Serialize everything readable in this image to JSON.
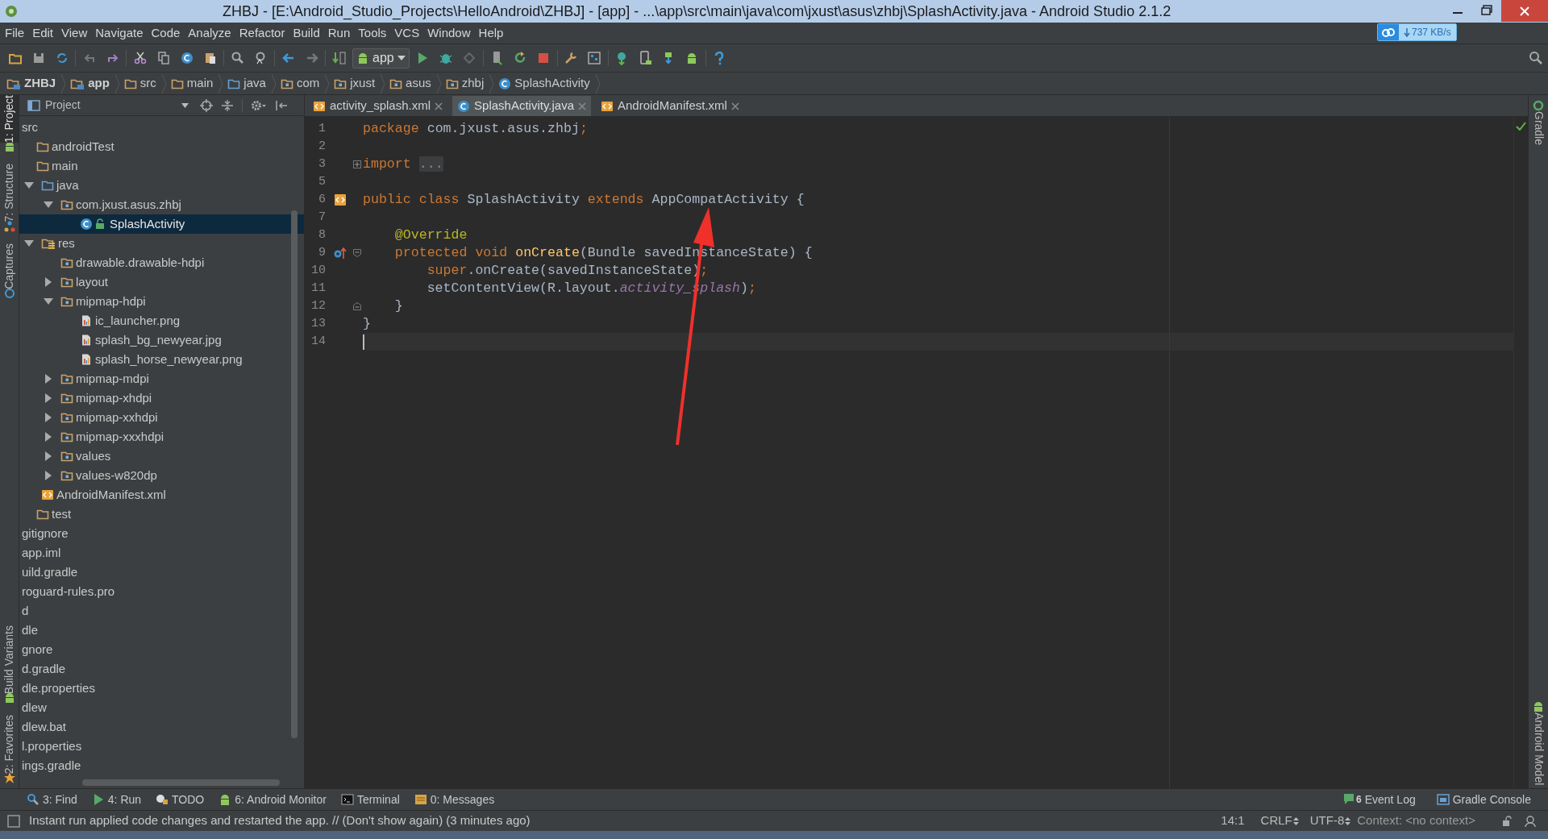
{
  "window": {
    "title": "ZHBJ - [E:\\Android_Studio_Projects\\HelloAndroid\\ZHBJ] - [app] - ...\\app\\src\\main\\java\\com\\jxust\\asus\\zhbj\\SplashActivity.java - Android Studio 2.1.2"
  },
  "network_widget": {
    "speed": "737 KB/s"
  },
  "menu": [
    "File",
    "Edit",
    "View",
    "Navigate",
    "Code",
    "Analyze",
    "Refactor",
    "Build",
    "Run",
    "Tools",
    "VCS",
    "Window",
    "Help"
  ],
  "toolbar": {
    "run_config": "app"
  },
  "breadcrumbs": [
    {
      "label": "ZHBJ",
      "kind": "project"
    },
    {
      "label": "app",
      "kind": "module"
    },
    {
      "label": "src",
      "kind": "folder"
    },
    {
      "label": "main",
      "kind": "folder"
    },
    {
      "label": "java",
      "kind": "source-folder"
    },
    {
      "label": "com",
      "kind": "package"
    },
    {
      "label": "jxust",
      "kind": "package"
    },
    {
      "label": "asus",
      "kind": "package"
    },
    {
      "label": "zhbj",
      "kind": "package"
    },
    {
      "label": "SplashActivity",
      "kind": "class"
    }
  ],
  "left_strip": {
    "top": [
      {
        "label": "1: Project",
        "selected": true
      },
      {
        "label": "7: Structure",
        "selected": false
      },
      {
        "label": "Captures",
        "selected": false
      }
    ],
    "bottom": [
      {
        "label": "Build Variants",
        "selected": false
      },
      {
        "label": "2: Favorites",
        "selected": false
      }
    ]
  },
  "right_strip": {
    "top": [
      "Gradle"
    ],
    "bottom": [
      "Android Model"
    ]
  },
  "project_panel": {
    "view": "Project",
    "tree": [
      {
        "label": "src",
        "selected": false,
        "children": [
          {
            "label": "androidTest",
            "kind": "folder",
            "selected": false
          },
          {
            "label": "main",
            "kind": "folder",
            "selected": false,
            "children": [
              {
                "label": "java",
                "kind": "source-folder",
                "expanded": true,
                "selected": false,
                "children": [
                  {
                    "label": "com.jxust.asus.zhbj",
                    "kind": "package",
                    "expanded": true,
                    "selected": false,
                    "children": [
                      {
                        "label": "SplashActivity",
                        "kind": "class",
                        "selected": true
                      }
                    ]
                  }
                ]
              },
              {
                "label": "res",
                "kind": "resources",
                "expanded": true,
                "selected": false,
                "children": [
                  {
                    "label": "drawable.drawable-hdpi",
                    "kind": "package",
                    "selected": false
                  },
                  {
                    "label": "layout",
                    "kind": "package",
                    "expanded": false,
                    "selected": false
                  },
                  {
                    "label": "mipmap-hdpi",
                    "kind": "package",
                    "expanded": true,
                    "selected": false,
                    "children": [
                      {
                        "label": "ic_launcher.png",
                        "kind": "image",
                        "selected": false
                      },
                      {
                        "label": "splash_bg_newyear.jpg",
                        "kind": "image",
                        "selected": false
                      },
                      {
                        "label": "splash_horse_newyear.png",
                        "kind": "image",
                        "selected": false
                      }
                    ]
                  },
                  {
                    "label": "mipmap-mdpi",
                    "kind": "package",
                    "expanded": false,
                    "selected": false
                  },
                  {
                    "label": "mipmap-xhdpi",
                    "kind": "package",
                    "expanded": false,
                    "selected": false
                  },
                  {
                    "label": "mipmap-xxhdpi",
                    "kind": "package",
                    "expanded": false,
                    "selected": false
                  },
                  {
                    "label": "mipmap-xxxhdpi",
                    "kind": "package",
                    "expanded": false,
                    "selected": false
                  },
                  {
                    "label": "values",
                    "kind": "package",
                    "expanded": false,
                    "selected": false
                  },
                  {
                    "label": "values-w820dp",
                    "kind": "package",
                    "expanded": false,
                    "selected": false
                  }
                ]
              },
              {
                "label": "AndroidManifest.xml",
                "kind": "manifest",
                "selected": false
              }
            ]
          },
          {
            "label": "test",
            "kind": "folder",
            "selected": false
          }
        ]
      },
      {
        "label": "gitignore",
        "selected": false
      },
      {
        "label": "app.iml",
        "selected": false
      },
      {
        "label": "uild.gradle",
        "selected": false
      },
      {
        "label": "roguard-rules.pro",
        "selected": false
      },
      {
        "label": "d",
        "selected": false
      },
      {
        "label": "dle",
        "selected": false
      },
      {
        "label": "gnore",
        "selected": false
      },
      {
        "label": "d.gradle",
        "selected": false
      },
      {
        "label": "dle.properties",
        "selected": false
      },
      {
        "label": "dlew",
        "selected": false
      },
      {
        "label": "dlew.bat",
        "selected": false
      },
      {
        "label": "l.properties",
        "selected": false
      },
      {
        "label": "ings.gradle",
        "selected": false
      }
    ]
  },
  "editor": {
    "tabs": [
      {
        "label": "activity_splash.xml",
        "kind": "xml",
        "selected": false
      },
      {
        "label": "SplashActivity.java",
        "kind": "class",
        "selected": true
      },
      {
        "label": "AndroidManifest.xml",
        "kind": "xml",
        "selected": false
      }
    ],
    "lines": [
      {
        "number": "1",
        "kind": "plain",
        "current": false,
        "tokens": [
          {
            "kind": "keyword",
            "text": "package"
          },
          {
            "kind": "plain",
            "text": " com.jxust.asus.zhbj"
          },
          {
            "kind": "punct",
            "text": ";"
          }
        ]
      },
      {
        "number": "2",
        "kind": "plain",
        "current": false
      },
      {
        "number": "3",
        "kind": "folded-block",
        "current": false,
        "tokens": [
          {
            "kind": "keyword",
            "text": "import "
          },
          {
            "kind": "folded",
            "text": "..."
          }
        ]
      },
      {
        "number": "5",
        "kind": "plain",
        "current": false
      },
      {
        "number": "6",
        "kind": "class-declaration",
        "current": false,
        "tokens": [
          {
            "kind": "keyword",
            "text": "public class"
          },
          {
            "kind": "plain",
            "text": " SplashActivity "
          },
          {
            "kind": "keyword",
            "text": "extends"
          },
          {
            "kind": "plain",
            "text": " AppCompatActivity {"
          }
        ]
      },
      {
        "number": "7",
        "kind": "plain",
        "current": false
      },
      {
        "number": "8",
        "kind": "plain",
        "current": false,
        "tokens": [
          {
            "kind": "annotation",
            "text": "    @Override"
          }
        ]
      },
      {
        "number": "9",
        "kind": "method-declaration",
        "current": false,
        "tokens": [
          {
            "kind": "keyword",
            "text": "    protected void "
          },
          {
            "kind": "method",
            "text": "onCreate"
          },
          {
            "kind": "plain",
            "text": "(Bundle savedInstanceState) {"
          }
        ]
      },
      {
        "number": "10",
        "kind": "plain",
        "current": false,
        "tokens": [
          {
            "kind": "keyword",
            "text": "        super"
          },
          {
            "kind": "plain",
            "text": ".onCreate(savedInstanceState)"
          },
          {
            "kind": "punct",
            "text": ";"
          }
        ]
      },
      {
        "number": "11",
        "kind": "plain",
        "current": false,
        "tokens": [
          {
            "kind": "plain",
            "text": "        setContentView(R.layout."
          },
          {
            "kind": "field",
            "text": "activity_splash"
          },
          {
            "kind": "plain",
            "text": ")"
          },
          {
            "kind": "punct",
            "text": ";"
          }
        ]
      },
      {
        "number": "12",
        "kind": "block-end",
        "current": false,
        "tokens": [
          {
            "kind": "plain",
            "text": "    }"
          }
        ]
      },
      {
        "number": "13",
        "kind": "plain",
        "current": false,
        "tokens": [
          {
            "kind": "plain",
            "text": "}"
          }
        ]
      },
      {
        "number": "14",
        "kind": "plain",
        "current": true
      }
    ]
  },
  "tool_buttons": {
    "left": [
      {
        "label": "3: Find",
        "kind": "find"
      },
      {
        "label": "4: Run",
        "kind": "run"
      },
      {
        "label": "TODO",
        "kind": "todo"
      },
      {
        "label": "6: Android Monitor",
        "kind": "android"
      },
      {
        "label": "Terminal",
        "kind": "terminal"
      },
      {
        "label": "0: Messages",
        "kind": "messages"
      }
    ],
    "right": [
      {
        "label": "Event Log",
        "kind": "event-log",
        "badge": "6"
      },
      {
        "label": "Gradle Console",
        "kind": "console"
      }
    ]
  },
  "status_bar": {
    "message": "Instant run applied code changes and restarted the app. // (Don't show again) (3 minutes ago)",
    "position": "14:1",
    "line_separator": "CRLF",
    "encoding": "UTF-8",
    "context": "Context: <no context>"
  }
}
